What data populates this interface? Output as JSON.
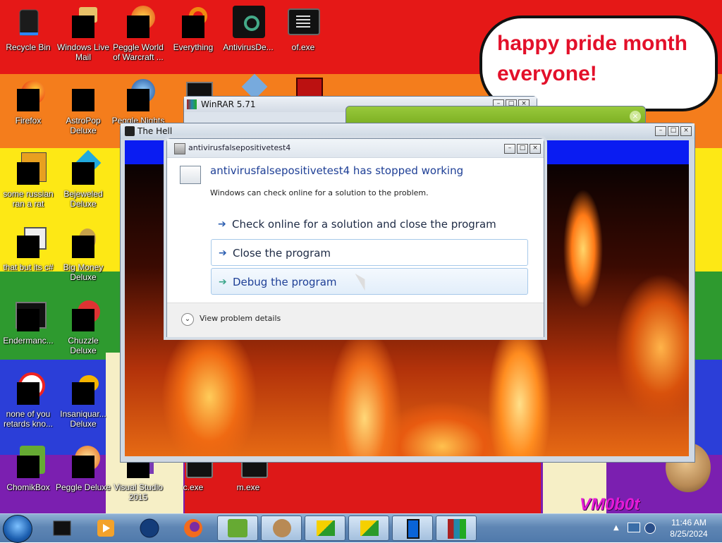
{
  "desktop": {
    "icons": [
      {
        "label": "Recycle Bin",
        "name": "recycle-bin-icon"
      },
      {
        "label": "Windows Live Mail",
        "name": "windows-live-mail-icon"
      },
      {
        "label": "Peggle World of Warcraft ...",
        "name": "peggle-wow-icon"
      },
      {
        "label": "Everything",
        "name": "everything-icon"
      },
      {
        "label": "AntivirusDe...",
        "name": "antivirus-icon"
      },
      {
        "label": "of.exe",
        "name": "of-exe-icon"
      },
      {
        "label": "Firefox",
        "name": "firefox-icon"
      },
      {
        "label": "AstroPop Deluxe",
        "name": "astropop-icon"
      },
      {
        "label": "Peggle Nights",
        "name": "peggle-nights-icon"
      },
      {
        "label": "some russian ran a rat",
        "name": "some-russian-icon"
      },
      {
        "label": "Bejeweled Deluxe",
        "name": "bejeweled-icon"
      },
      {
        "label": "that but its c#",
        "name": "that-but-icon"
      },
      {
        "label": "Big Money Deluxe",
        "name": "big-money-icon"
      },
      {
        "label": "Endermanc...",
        "name": "endermanch-icon"
      },
      {
        "label": "Chuzzle Deluxe",
        "name": "chuzzle-icon"
      },
      {
        "label": "none of you retards kno...",
        "name": "none-of-you-icon"
      },
      {
        "label": "Insaniquar... Deluxe",
        "name": "insaniquarium-icon"
      },
      {
        "label": "ChomikBox",
        "name": "chomikbox-icon"
      },
      {
        "label": "Peggle Deluxe",
        "name": "peggle-deluxe-icon"
      },
      {
        "label": "Visual Studio 2015",
        "name": "visual-studio-icon"
      },
      {
        "label": "c.exe",
        "name": "c-exe-icon"
      },
      {
        "label": "m.exe",
        "name": "m-exe-icon"
      }
    ],
    "speech_bubble": "happy pride month everyone!",
    "watermark": "VM0b0t"
  },
  "windows": {
    "winrar_title": "WinRAR 5.71",
    "hell_title": "The Hell",
    "error_dialog": {
      "title": "antivirusfalsepositivetest4",
      "heading": "antivirusfalsepositivetest4 has stopped working",
      "subtext": "Windows can check online for a solution to the problem.",
      "options": [
        "Check online for a solution and close the program",
        "Close the program",
        "Debug the program"
      ],
      "footer": "View problem details"
    }
  },
  "taskbar": {
    "time": "11:46 AM",
    "date": "8/25/2024"
  },
  "colors": {
    "pride_red": "#e51817",
    "pride_orange": "#f47d1c",
    "pride_yellow": "#fde815",
    "pride_green": "#2e9a2f",
    "pride_blue": "#2b3ed8",
    "pride_purple": "#7b1fb0",
    "dialog_link_blue": "#1e3f96"
  }
}
